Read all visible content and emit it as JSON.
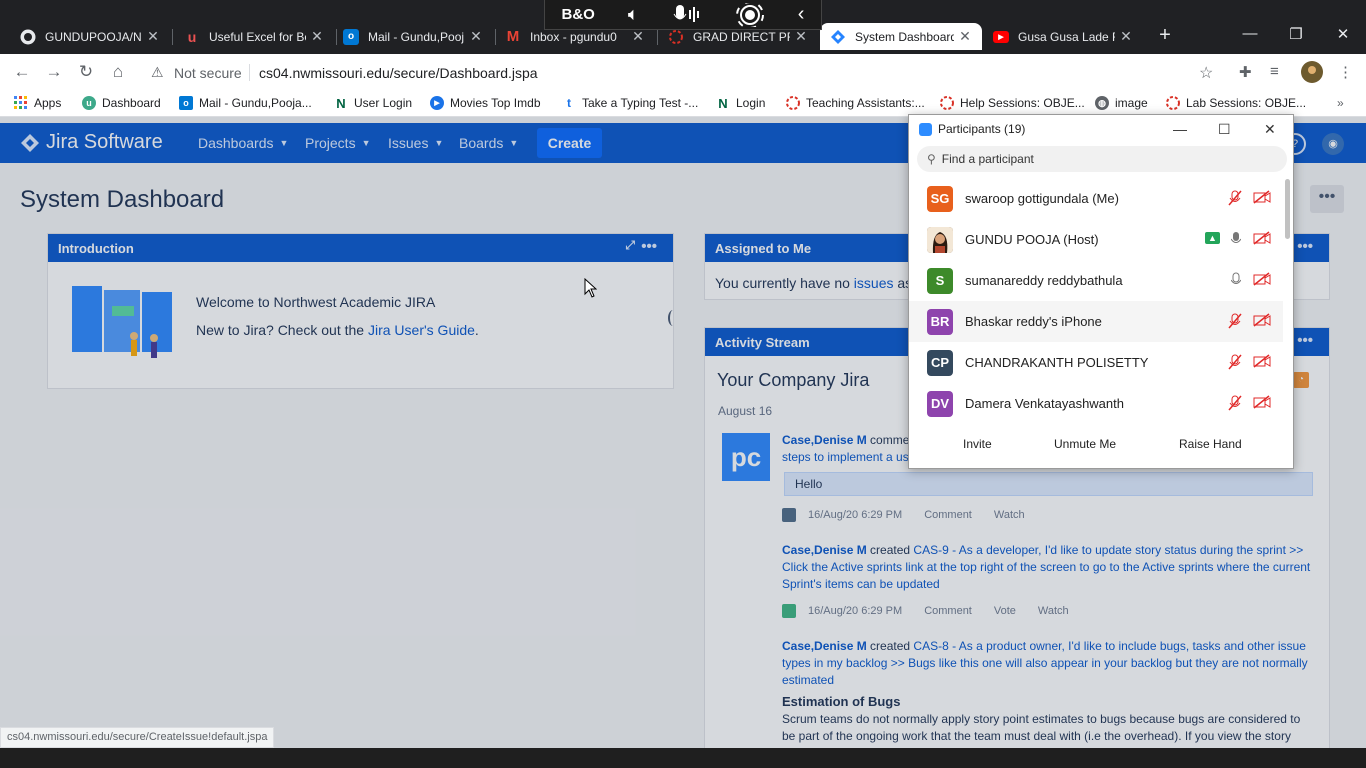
{
  "browser": {
    "tabs": [
      {
        "title": "GUNDUPOOJA/N...",
        "favicon": "github-icon"
      },
      {
        "title": "Useful Excel for Be",
        "favicon": "udemy-icon"
      },
      {
        "title": "Mail - Gundu,Pooj",
        "favicon": "outlook-icon"
      },
      {
        "title": "Inbox - pgundu0",
        "favicon": "gmail-icon"
      },
      {
        "title": "GRAD DIRECT PRO",
        "favicon": "circle-icon"
      },
      {
        "title": "System Dashboard",
        "favicon": "jira-icon",
        "active": true
      },
      {
        "title": "Gusa Gusa Lade F",
        "favicon": "youtube-icon"
      }
    ],
    "address": {
      "security": "Not secure",
      "url": "cs04.nwmissouri.edu/secure/Dashboard.jspa"
    },
    "bookmarks": [
      {
        "label": "Apps",
        "icon": "apps-grid-icon"
      },
      {
        "label": "Dashboard",
        "icon": "dashboard-icon"
      },
      {
        "label": "Mail - Gundu,Pooja...",
        "icon": "outlook-icon"
      },
      {
        "label": "User Login",
        "icon": "n-logo-icon"
      },
      {
        "label": "Movies Top Imdb",
        "icon": "play-icon"
      },
      {
        "label": "Take a Typing Test -...",
        "icon": "typing-icon"
      },
      {
        "label": "Login",
        "icon": "n-logo-icon"
      },
      {
        "label": "Teaching Assistants:...",
        "icon": "circle-icon"
      },
      {
        "label": "Help Sessions: OBJE...",
        "icon": "circle-icon"
      },
      {
        "label": "image",
        "icon": "globe-icon"
      },
      {
        "label": "Lab Sessions: OBJE...",
        "icon": "circle-icon"
      }
    ],
    "status_url": "cs04.nwmissouri.edu/secure/CreateIssue!default.jspa"
  },
  "jira": {
    "brand": "Jira Software",
    "menu": [
      "Dashboards",
      "Projects",
      "Issues",
      "Boards"
    ],
    "create_label": "Create",
    "page_title": "System Dashboard",
    "introduction": {
      "title": "Introduction",
      "welcome": "Welcome to Northwest Academic JIRA",
      "new_prefix": "New to Jira? Check out the ",
      "guide_link": "Jira User's Guide",
      "new_suffix": "."
    },
    "assigned": {
      "title": "Assigned to Me",
      "text_prefix": "You currently have no ",
      "link": "issues",
      "text_suffix": " ass"
    },
    "activity": {
      "title": "Activity Stream",
      "heading": "Your Company Jira",
      "date": "August 16",
      "avatar_text": "pc",
      "item1_user": "Case,Denise M",
      "item1_text": " comme",
      "item1_link": "steps to implement a us",
      "item1_comment": "Hello",
      "item1_meta": [
        "16/Aug/20 6:29 PM",
        "Comment",
        "Watch"
      ],
      "item2_user": "Case,Denise M",
      "item2_verb": " created ",
      "item2_link": "CAS-9 - As a developer, I'd like to update story status during the sprint >> Click the Active sprints link at the top right of the screen to go to the Active sprints where the current Sprint's items can be updated",
      "item2_meta": [
        "16/Aug/20 6:29 PM",
        "Comment",
        "Vote",
        "Watch"
      ],
      "item3_user": "Case,Denise M",
      "item3_verb": " created ",
      "item3_link": "CAS-8 - As a product owner, I'd like to include bugs, tasks and other issue types in my backlog >> Bugs like this one will also appear in your backlog but they are not normally estimated",
      "estimation_title": "Estimation of Bugs",
      "estimation_text": "Scrum teams do not normally apply story point estimates to bugs because bugs are considered to be part of the ongoing work that the team must deal with (i.e the overhead). If you view the story"
    }
  },
  "zoom": {
    "title": "Participants (19)",
    "search_placeholder": "Find a participant",
    "participants": [
      {
        "initials": "SG",
        "name": "swaroop gottigundala (Me)",
        "color": "#e8601c"
      },
      {
        "initials": "",
        "name": "GUNDU POOJA (Host)",
        "color": "#7a5a3a"
      },
      {
        "initials": "S",
        "name": "sumanareddy reddybathula",
        "color": "#3d8a2a"
      },
      {
        "initials": "BR",
        "name": "Bhaskar reddy's iPhone",
        "color": "#8e44ad"
      },
      {
        "initials": "CP",
        "name": "CHANDRAKANTH POLISETTY",
        "color": "#34495e"
      },
      {
        "initials": "DV",
        "name": "Damera Venkatayashwanth",
        "color": "#8e44ad"
      }
    ],
    "buttons": [
      "Invite",
      "Unmute Me",
      "Raise Hand"
    ]
  }
}
